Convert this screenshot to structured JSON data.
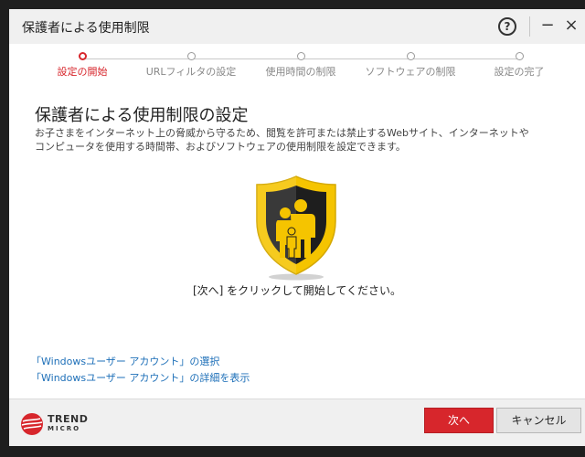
{
  "window": {
    "title": "保護者による使用制限",
    "help_glyph": "?",
    "minimize_glyph": "−",
    "close_glyph": "×"
  },
  "steps": [
    {
      "label": "設定の開始",
      "active": true
    },
    {
      "label": "URLフィルタの設定",
      "active": false
    },
    {
      "label": "使用時間の制限",
      "active": false
    },
    {
      "label": "ソフトウェアの制限",
      "active": false
    },
    {
      "label": "設定の完了",
      "active": false
    }
  ],
  "main": {
    "heading": "保護者による使用制限の設定",
    "description_line1": "お子さまをインターネット上の脅威から守るため、閲覧を許可または禁止するWebサイト、インターネットや",
    "description_line2": "コンピュータを使用する時間帯、およびソフトウェアの使用制限を設定できます。",
    "instruction": "[次へ] をクリックして開始してください。",
    "link_select_account": "「Windowsユーザー アカウント」の選択",
    "link_account_details": "「Windowsユーザー アカウント」の詳細を表示"
  },
  "footer": {
    "logo_line1": "TREND",
    "logo_line2": "MICRO",
    "next_label": "次へ",
    "cancel_label": "キャンセル"
  },
  "icons": {
    "shield": "family-shield-icon",
    "logo": "trend-micro-logo"
  },
  "colors": {
    "accent": "#d7262c",
    "link": "#1d6fb8",
    "shield_yellow": "#f5c400",
    "shield_dark": "#1e1e1e"
  }
}
